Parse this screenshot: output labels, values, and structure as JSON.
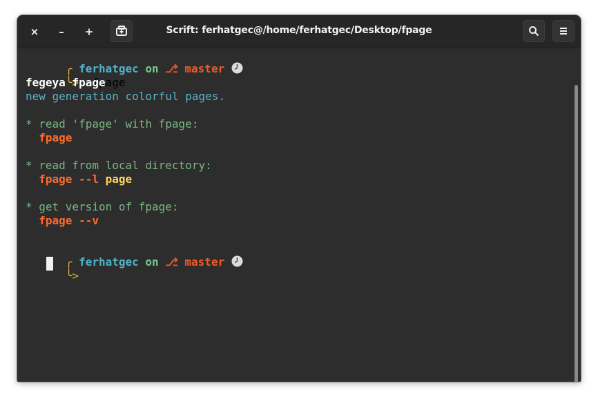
{
  "window": {
    "title": "Scrift: ferhatgec@/home/ferhatgec/Desktop/fpage",
    "close_label": "×",
    "minimize_label": "–",
    "maximize_label": "+"
  },
  "colors": {
    "user": "#4fb3c8",
    "on": "#77c98c",
    "branch": "#ee5a2a",
    "prompt_bracket": "#e6b33c",
    "description": "#5ab3c9",
    "comment": "#79b883",
    "command": "#ff6b2b",
    "argument": "#ffd45c",
    "plain": "#ffffff",
    "background": "#2d2d2d"
  },
  "prompt": {
    "user": "ferhatgec",
    "on": "on",
    "branch_icon": "⎇",
    "branch": "master",
    "clock_icon": "clock-icon",
    "arrow": "╰>",
    "corner": "╭"
  },
  "session": {
    "command": "fpage",
    "output": {
      "heading": "fegeya fpage",
      "tagline": "new generation colorful pages.",
      "items": [
        {
          "comment": "* read 'fpage' with fpage:",
          "cmd": "fpage",
          "flag": "",
          "arg": ""
        },
        {
          "comment": "* read from local directory:",
          "cmd": "fpage",
          "flag": "--l",
          "arg": "page"
        },
        {
          "comment": "* get version of fpage:",
          "cmd": "fpage",
          "flag": "--v",
          "arg": ""
        }
      ]
    }
  }
}
